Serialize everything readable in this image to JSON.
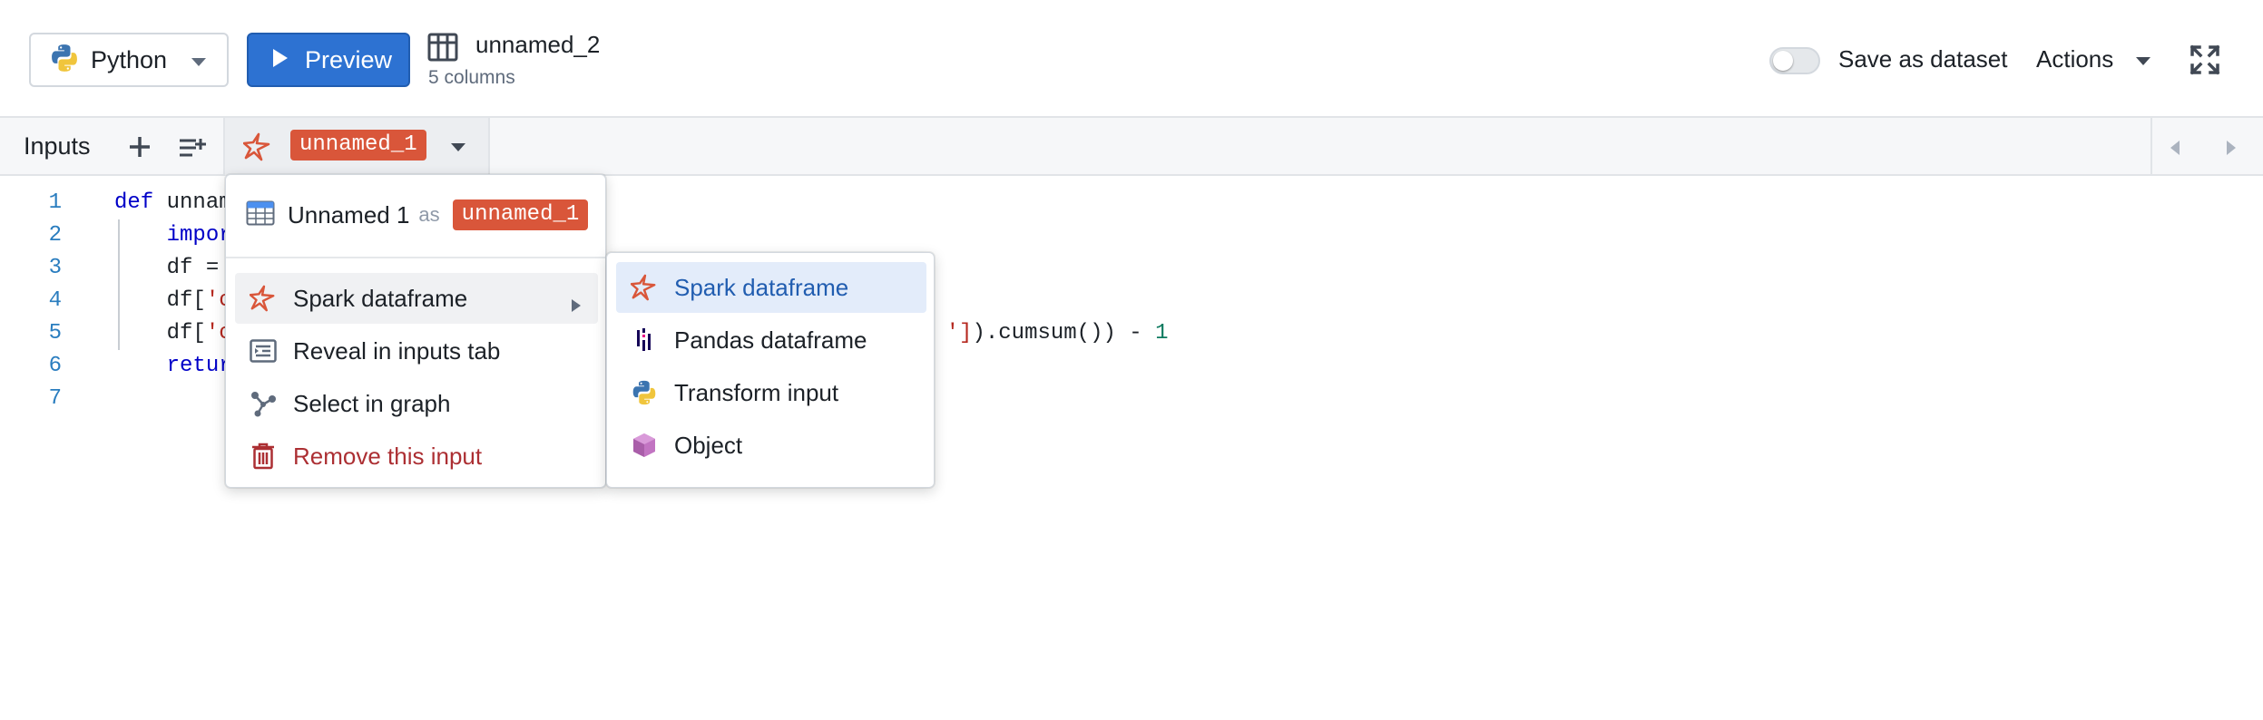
{
  "toolbar": {
    "language_label": "Python",
    "preview_label": "Preview",
    "dataset_name": "unnamed_2",
    "dataset_columns": "5 columns",
    "save_as_dataset_label": "Save as dataset",
    "save_as_dataset_enabled": false,
    "actions_label": "Actions"
  },
  "tabs": {
    "inputs_label": "Inputs",
    "active_tab_alias": "unnamed_1"
  },
  "editor": {
    "line_numbers": [
      "1",
      "2",
      "3",
      "4",
      "5",
      "6",
      "7"
    ],
    "lines": {
      "l1_kw": "def",
      "l1_rest": " unnam",
      "l2_kw": "impor",
      "l3_rest": "df =",
      "l4_pre": "df[",
      "l4_str": "'c",
      "l5_pre": "df[",
      "l5_str": "'c",
      "l5_mid_str": "']",
      "l5_tail": ").cumsum()) - ",
      "l5_num": "1",
      "l6_kw": "retur"
    }
  },
  "context_menu": {
    "header_name": "Unnamed 1",
    "header_as": "as",
    "header_alias": "unnamed_1",
    "items": [
      {
        "label": "Spark dataframe",
        "icon": "spark-icon"
      },
      {
        "label": "Reveal in inputs tab",
        "icon": "reveal-icon"
      },
      {
        "label": "Select in graph",
        "icon": "graph-icon"
      },
      {
        "label": "Remove this input",
        "icon": "trash-icon"
      }
    ]
  },
  "submenu": {
    "items": [
      {
        "label": "Spark dataframe",
        "icon": "spark-icon",
        "selected": true
      },
      {
        "label": "Pandas dataframe",
        "icon": "pandas-icon"
      },
      {
        "label": "Transform input",
        "icon": "python-icon"
      },
      {
        "label": "Object",
        "icon": "cube-icon"
      }
    ]
  },
  "colors": {
    "primary": "#2d72d2",
    "alias_chip": "#d9563a",
    "danger": "#ac2f33",
    "selected_bg": "#e3ecfa"
  }
}
